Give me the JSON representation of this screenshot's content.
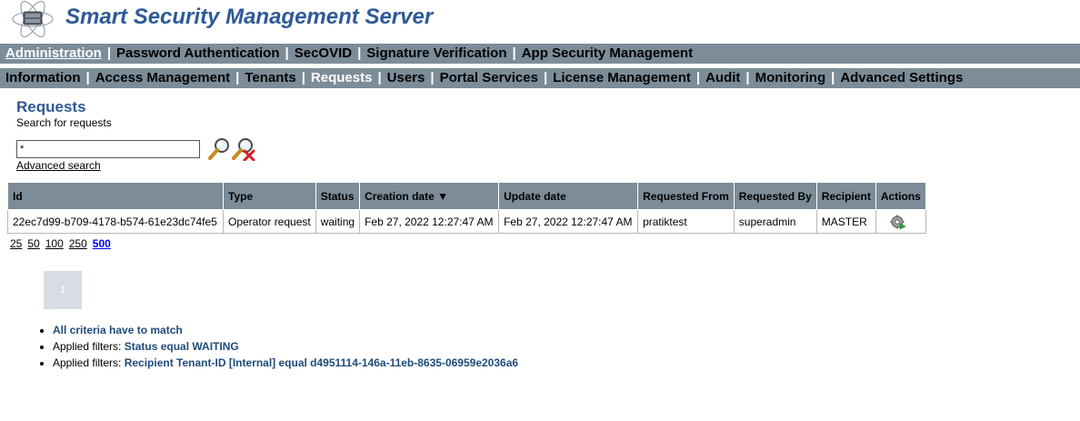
{
  "header": {
    "app_title": "Smart Security Management Server"
  },
  "nav_primary": [
    {
      "label": "Administration",
      "active": true
    },
    {
      "label": "Password Authentication"
    },
    {
      "label": "SecOVID"
    },
    {
      "label": "Signature Verification"
    },
    {
      "label": "App Security Management"
    }
  ],
  "nav_secondary": [
    {
      "label": "Information"
    },
    {
      "label": "Access Management"
    },
    {
      "label": "Tenants"
    },
    {
      "label": "Requests",
      "active": true
    },
    {
      "label": "Users"
    },
    {
      "label": "Portal Services"
    },
    {
      "label": "License Management"
    },
    {
      "label": "Audit"
    },
    {
      "label": "Monitoring"
    },
    {
      "label": "Advanced Settings"
    }
  ],
  "page": {
    "title": "Requests",
    "subtitle": "Search for requests"
  },
  "search": {
    "value": "*",
    "advanced_label": "Advanced search"
  },
  "table": {
    "columns": [
      "Id",
      "Type",
      "Status",
      "Creation date ▼",
      "Update date",
      "Requested From",
      "Requested By",
      "Recipient",
      "Actions"
    ],
    "rows": [
      {
        "id": "22ec7d99-b709-4178-b574-61e23dc74fe5",
        "type": "Operator request",
        "status": "waiting",
        "creation_date": "Feb 27, 2022 12:27:47 AM",
        "update_date": "Feb 27, 2022 12:27:47 AM",
        "requested_from": "pratiktest",
        "requested_by": "superadmin",
        "recipient": "MASTER",
        "action_icon": "gear-run-icon"
      }
    ]
  },
  "page_sizes": [
    {
      "label": "25"
    },
    {
      "label": "50"
    },
    {
      "label": "100"
    },
    {
      "label": "250"
    },
    {
      "label": "500",
      "active": true
    }
  ],
  "pagination": {
    "current": "1"
  },
  "criteria": [
    {
      "label": "",
      "value": "All criteria have to match"
    },
    {
      "label": "Applied filters: ",
      "value": "Status equal WAITING"
    },
    {
      "label": "Applied filters: ",
      "value": "Recipient Tenant-ID [Internal] equal d4951114-146a-11eb-8635-06959e2036a6"
    }
  ],
  "colors": {
    "brand": "#2e5a96",
    "nav_bg": "#7c8c99",
    "filter_value": "#1f4b7a",
    "link_active": "#0000ee"
  }
}
